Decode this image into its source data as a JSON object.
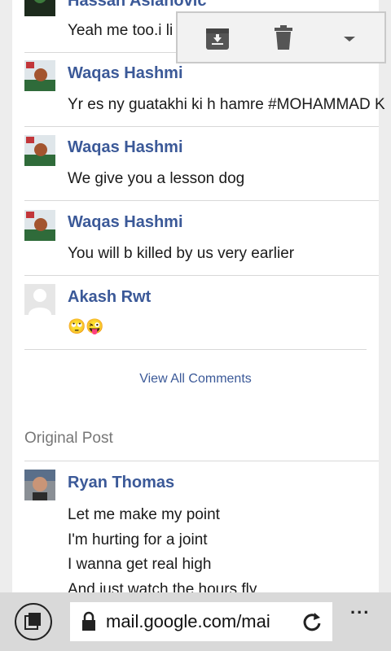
{
  "comments": [
    {
      "name": "Hassan Aslanovic",
      "text": "Yeah me too.i li",
      "avatar": "dark-avatar"
    },
    {
      "name": "Waqas Hashmi",
      "text": "Yr es ny guatakhi ki h hamre #MOHAMMAD K",
      "avatar": "photo-avatar"
    },
    {
      "name": "Waqas Hashmi",
      "text": "We give you a lesson dog",
      "avatar": "photo-avatar"
    },
    {
      "name": "Waqas Hashmi",
      "text": "You will b killed by us very earlier",
      "avatar": "photo-avatar"
    },
    {
      "name": "Akash Rwt",
      "text": "🙄😜",
      "avatar": "default-avatar"
    }
  ],
  "view_all_label": "View All Comments",
  "original_post": {
    "section_label": "Original Post",
    "name": "Ryan Thomas",
    "lines": [
      "Let me make my point",
      "I'm hurting for a joint",
      "I wanna get real high",
      "And just watch the hours fly"
    ]
  },
  "popup": {
    "icons": [
      "archive-icon",
      "trash-icon",
      "dropdown-arrow-icon"
    ]
  },
  "browser": {
    "url": "mail.google.com/mai",
    "icons": [
      "tabs-icon",
      "lock-icon",
      "refresh-icon",
      "more-icon"
    ],
    "more_label": "..."
  },
  "colors": {
    "name": "#3b5998",
    "text": "#1a1a1a",
    "bar": "#d9d9d9"
  }
}
